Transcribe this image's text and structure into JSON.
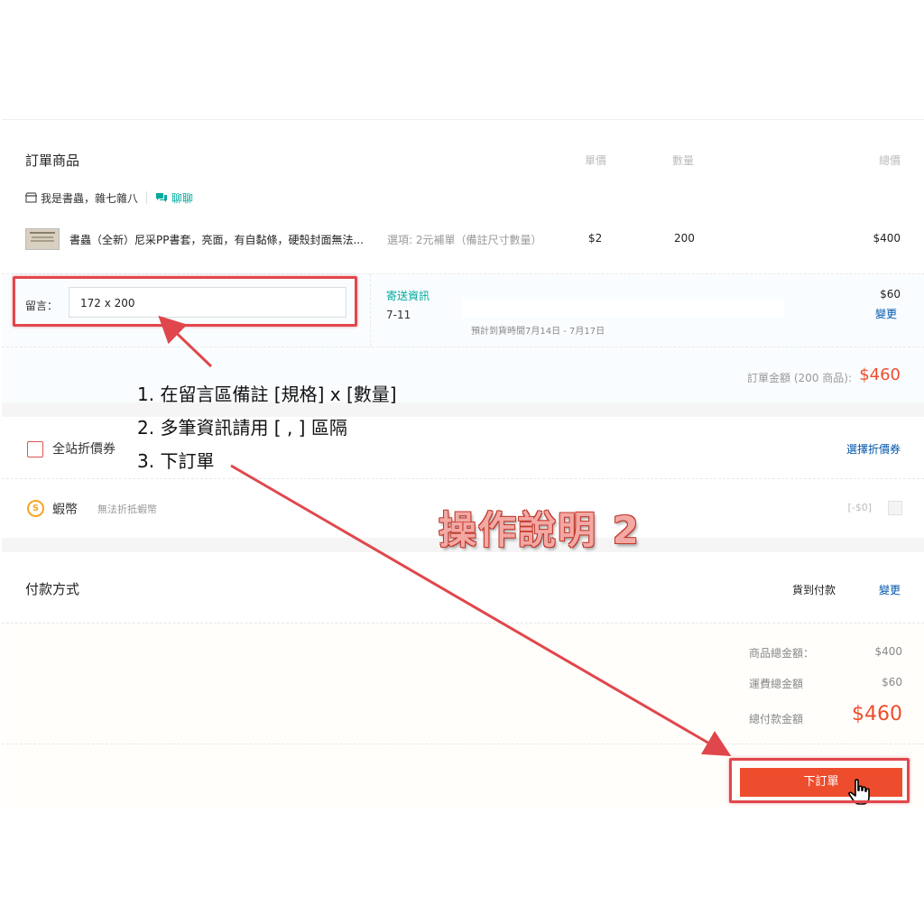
{
  "order": {
    "section_title": "訂單商品",
    "col_unit_price": "單價",
    "col_quantity": "數量",
    "col_total": "總價",
    "shop_name": "我是書蟲，雜七雜八",
    "chat_label": "聊聊",
    "item": {
      "name": "書蟲（全新）尼采PP書套，亮面，有自黏條，硬殼封面無法...",
      "variation": "選項: 2元補單（備註尺寸數量）",
      "unit_price": "$2",
      "quantity": "200",
      "total": "$400"
    },
    "message_label": "留言：",
    "message_value": "172 x 200",
    "shipping_title": "寄送資訊",
    "shipping_method": "7-11",
    "shipping_eta": "預計到貨時間7月14日 - 7月17日",
    "shipping_fee": "$60",
    "shipping_change": "變更",
    "order_total_label": "訂單金額 (200 商品):",
    "order_total_value": "$460"
  },
  "voucher": {
    "label": "全站折價券",
    "select_label": "選擇折價券"
  },
  "coins": {
    "label": "蝦幣",
    "note": "無法折抵蝦幣",
    "value": "[-$0]"
  },
  "payment": {
    "title": "付款方式",
    "method": "貨到付款",
    "change": "變更",
    "merch_total_label": "商品總金額：",
    "merch_total_value": "$400",
    "shipping_total_label": "運費總金額",
    "shipping_total_value": "$60",
    "grand_total_label": "總付款金額",
    "grand_total_value": "$460",
    "place_order": "下訂單"
  },
  "annotation": {
    "step1": "1. 在留言區備註 [規格] x [數量]",
    "step2": "2. 多筆資訊請用 [ , ] 區隔",
    "step3": "3. 下訂單",
    "heading": "操作說明 2"
  },
  "colors": {
    "accent": "#ee4d2d",
    "teal": "#00a99d",
    "highlight_box": "#e0474c"
  }
}
